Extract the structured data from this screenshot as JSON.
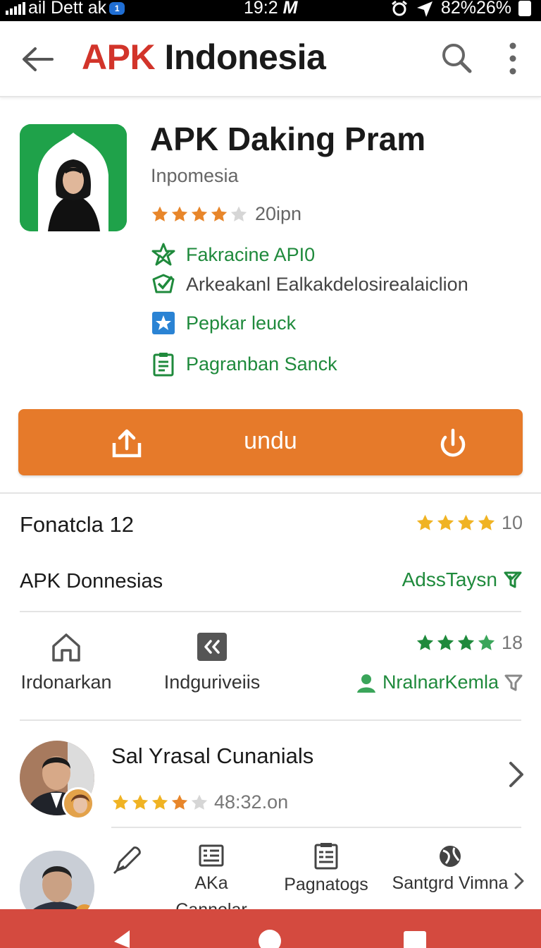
{
  "status_bar": {
    "carrier": "ail Dett ak",
    "sim_badge": "1",
    "time": "19:2",
    "notif": "M",
    "battery_text": "82%26%"
  },
  "app_bar": {
    "title_accent": "APK",
    "title_rest": "Indonesia",
    "accent_color": "#d2342a",
    "back_icon": "arrow-left-icon",
    "search_icon": "search-icon",
    "more_icon": "more-vert-icon"
  },
  "app": {
    "name": "APK Daking Pram",
    "developer": "Inpomesia",
    "rating_stars": 4,
    "rating_text": "20ipn",
    "features": [
      {
        "label": "Fakracine API0",
        "icon": "verified-star-icon",
        "color": "green"
      },
      {
        "label": "Arkeakanl Ealkakdelosirealaiclion",
        "icon": "check-shield-icon",
        "color": "gray"
      },
      {
        "label": "Pepkar leuck",
        "icon": "star-badge-icon",
        "color": "green"
      },
      {
        "label": "Pagranban Sanck",
        "icon": "clipboard-icon",
        "color": "green"
      }
    ]
  },
  "download": {
    "label": "undu",
    "left_icon": "share-upload-icon",
    "right_icon": "power-icon",
    "color": "#e67a2a"
  },
  "info": {
    "row1_label": "Fonatcla 12",
    "row1_stars": 4,
    "row1_count": "10",
    "row2_label": "APK Donnesias",
    "row2_link": "AdssTaysn"
  },
  "nav": {
    "items": [
      {
        "label": "Irdonarkan",
        "icon": "home-icon"
      },
      {
        "label": "Indguriveiis",
        "icon": "rewind-icon"
      }
    ],
    "right_stars": 4,
    "right_count": "18",
    "right_label": "NralnarKemla"
  },
  "review": {
    "name": "Sal Yrasal Cunanials",
    "stars": 4,
    "meta": "48:32.on"
  },
  "bottom_tabs": [
    {
      "label": "",
      "icon": "pen-icon"
    },
    {
      "label": "AKa",
      "icon": "list-card-icon"
    },
    {
      "label": "Pagnatogs",
      "icon": "document-list-icon"
    },
    {
      "label": "Santgrd Vimna",
      "icon": "globe-icon"
    }
  ],
  "bottom_peek": "Cannolar",
  "system_nav": {
    "back_icon": "triangle-back-icon",
    "home_icon": "circle-home-icon",
    "recents_icon": "square-recents-icon"
  }
}
